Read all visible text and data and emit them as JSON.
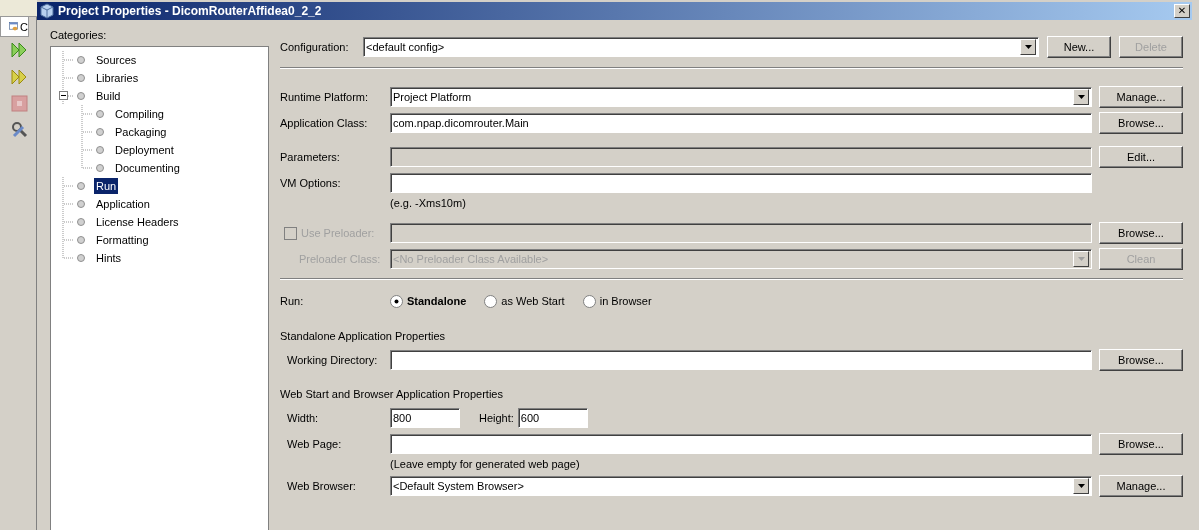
{
  "ide": {
    "tab_label": "C"
  },
  "window": {
    "title": "Project Properties - DicomRouterAffidea0_2_2",
    "close": "✕"
  },
  "categories": {
    "label": "Categories:",
    "items": [
      {
        "label": "Sources",
        "selected": false
      },
      {
        "label": "Libraries",
        "selected": false
      },
      {
        "label": "Build",
        "selected": false,
        "expanded": true,
        "children": [
          {
            "label": "Compiling",
            "selected": false
          },
          {
            "label": "Packaging",
            "selected": false
          },
          {
            "label": "Deployment",
            "selected": false
          },
          {
            "label": "Documenting",
            "selected": false
          }
        ]
      },
      {
        "label": "Run",
        "selected": true
      },
      {
        "label": "Application",
        "selected": false
      },
      {
        "label": "License Headers",
        "selected": false
      },
      {
        "label": "Formatting",
        "selected": false
      },
      {
        "label": "Hints",
        "selected": false
      }
    ]
  },
  "configuration": {
    "label": "Configuration:",
    "value": "<default config>",
    "buttons": [
      {
        "label": "New...",
        "disabled": false
      },
      {
        "label": "Delete",
        "disabled": true
      }
    ]
  },
  "groups": [
    {
      "kind": "separator"
    },
    {
      "kind": "rows",
      "rows": [
        {
          "kind": "combo",
          "label": "Runtime Platform:",
          "value": "Project Platform",
          "disabled": false,
          "button": {
            "label": "Manage...",
            "disabled": false
          }
        },
        {
          "kind": "text",
          "label": "Application Class:",
          "value": "com.npap.dicomrouter.Main",
          "disabled": false,
          "button": {
            "label": "Browse...",
            "disabled": false
          }
        }
      ]
    },
    {
      "kind": "rows",
      "rows": [
        {
          "kind": "text",
          "label": "Parameters:",
          "value": "",
          "disabled": true,
          "button": {
            "label": "Edit...",
            "disabled": false
          }
        },
        {
          "kind": "text",
          "label": "VM Options:",
          "value": "",
          "disabled": false
        },
        {
          "kind": "hint",
          "text": "(e.g. -Xms10m)"
        }
      ]
    },
    {
      "kind": "rows",
      "rows": [
        {
          "kind": "check",
          "label": "Use Preloader:",
          "checked": false,
          "disabled": true,
          "value": "",
          "button": {
            "label": "Browse...",
            "disabled": false
          }
        },
        {
          "kind": "combo",
          "label": "Preloader Class:",
          "nested": true,
          "value": "<No Preloader Class Available>",
          "disabled": true,
          "button": {
            "label": "Clean",
            "disabled": true
          }
        }
      ]
    },
    {
      "kind": "separator"
    },
    {
      "kind": "rows",
      "rows": [
        {
          "kind": "radio",
          "label": "Run:",
          "options": [
            {
              "label": "Standalone",
              "selected": true
            },
            {
              "label": "as Web Start",
              "selected": false
            },
            {
              "label": "in Browser",
              "selected": false
            }
          ]
        }
      ]
    },
    {
      "kind": "rows",
      "heading": "Standalone Application Properties",
      "rows": [
        {
          "kind": "text",
          "label": "Working Directory:",
          "value": "",
          "disabled": false,
          "button": {
            "label": "Browse...",
            "disabled": false
          }
        }
      ]
    },
    {
      "kind": "rows",
      "heading": "Web Start and Browser Application Properties",
      "rows": [
        {
          "kind": "size",
          "fields": [
            {
              "label": "Width:",
              "value": "800"
            },
            {
              "label": "Height:",
              "value": "600"
            }
          ]
        },
        {
          "kind": "text",
          "label": "Web Page:",
          "value": "",
          "disabled": false,
          "button": {
            "label": "Browse...",
            "disabled": false
          }
        },
        {
          "kind": "hint",
          "text": "(Leave empty for generated web page)"
        },
        {
          "kind": "combo",
          "label": "Web Browser:",
          "value": "<Default System Browser>",
          "disabled": false,
          "button": {
            "label": "Manage...",
            "disabled": false
          }
        }
      ]
    }
  ]
}
